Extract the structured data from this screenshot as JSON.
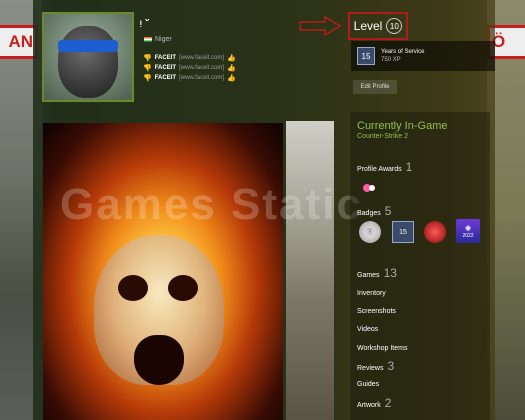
{
  "background": {
    "sign_left": "AN",
    "sign_right": "Ö"
  },
  "profile": {
    "username": "ᵎ ˇ",
    "country": "Niger",
    "level_label": "Level",
    "level_value": "10",
    "years_badge": {
      "icon_text": "15",
      "title": "Years of Service",
      "xp": "750 XP"
    },
    "edit_button": "Edit Profile"
  },
  "faceit": [
    {
      "name": "FACEIT",
      "url": "[www.faceit.com]"
    },
    {
      "name": "FACEIT",
      "url": "[www.faceit.com]"
    },
    {
      "name": "FACEIT",
      "url": "[www.faceit.com]"
    }
  ],
  "showcase": {
    "watermark": "Games Static"
  },
  "sidebar": {
    "status": "Currently In-Game",
    "game": "Counter-Strike 2",
    "profile_awards": {
      "label": "Profile Awards",
      "count": "1"
    },
    "badges": {
      "label": "Badges",
      "count": "5",
      "items": [
        {
          "icon": "coin-badge-icon",
          "text": "Ⓡ"
        },
        {
          "icon": "years-15-badge-icon",
          "text": "15"
        },
        {
          "icon": "red-badge-icon",
          "text": ""
        },
        {
          "icon": "steam-2022-badge-icon",
          "text": "2022"
        }
      ]
    },
    "games": {
      "label": "Games",
      "count": "13"
    },
    "links": [
      "Inventory",
      "Screenshots",
      "Videos",
      "Workshop Items"
    ],
    "reviews": {
      "label": "Reviews",
      "count": "3"
    },
    "guides": "Guides",
    "artwork": {
      "label": "Artwork",
      "count": "2"
    }
  },
  "colors": {
    "in_game_green": "#8fc04d",
    "level_border": "#b01c1c",
    "avatar_border": "#6b8a2c"
  }
}
